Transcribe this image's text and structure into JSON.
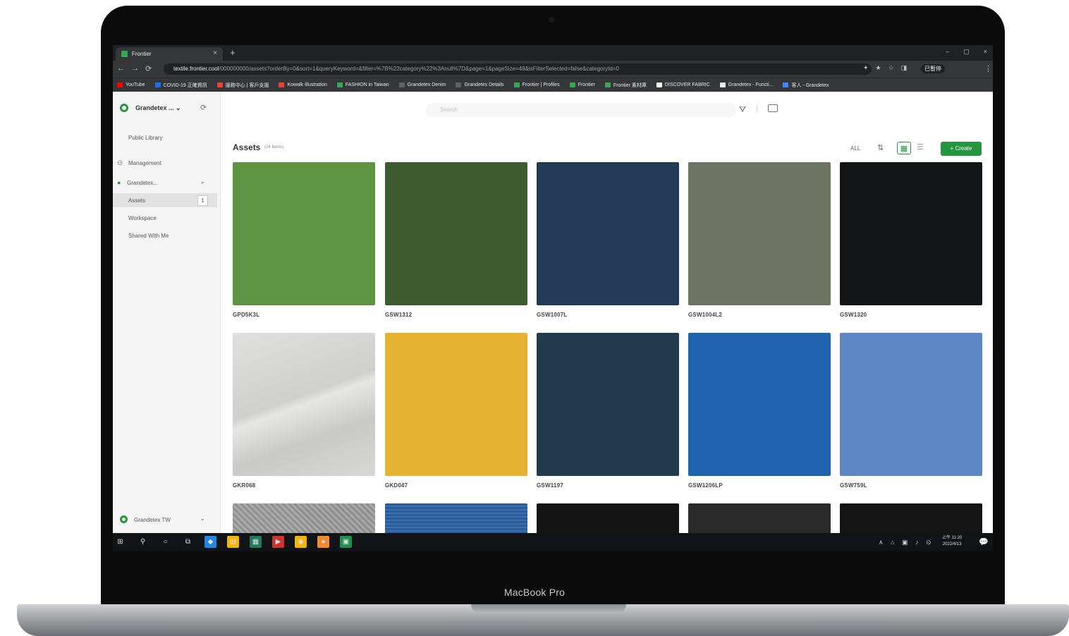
{
  "device": {
    "brand_label": "MacBook Pro"
  },
  "browser": {
    "tab_title": "Frontier",
    "tab_close": "×",
    "new_tab": "+",
    "window_controls": [
      "–",
      "▢",
      "×"
    ],
    "nav": {
      "back": "←",
      "forward": "→",
      "reload": "⟳",
      "lock": "🔒"
    },
    "url_host": "textile.frontier.cool",
    "url_rest": "/000000000/assets?orderBy=0&sort=1&queryKeyword=&filter=%7B%22category%22%3Anull%7D&page=1&pageSize=48&isFilterSelected=false&categoryId=0",
    "extensions": [
      "✦",
      "★",
      "☆",
      "◨"
    ],
    "profile_label": "已暫停",
    "bookmarks": [
      {
        "label": "YouTube",
        "color": "#ff0000"
      },
      {
        "label": "COVID-19 正確資訊",
        "color": "#1a73e8"
      },
      {
        "label": "服務中心 | 客戶支援",
        "color": "#ea4335"
      },
      {
        "label": "Kowalk Illustration",
        "color": "#ea4335"
      },
      {
        "label": "FASHION in Taiwan",
        "color": "#34a853"
      },
      {
        "label": "Grandetex Denim",
        "color": "#5f6368"
      },
      {
        "label": "Grandetex Details",
        "color": "#5f6368"
      },
      {
        "label": "Frontier | Profiles",
        "color": "#34a853"
      },
      {
        "label": "Frontier",
        "color": "#34a853"
      },
      {
        "label": "Frontier 素材庫",
        "color": "#34a853"
      },
      {
        "label": "DISCOVER FABRIC",
        "color": "#ffffff"
      },
      {
        "label": "Grandetex - Functi...",
        "color": "#e8eaed"
      },
      {
        "label": "客人 - Grandetex",
        "color": "#4285f4"
      }
    ]
  },
  "sidebar": {
    "org_name": "Grandetex ...",
    "org_caret": "⌄",
    "refresh_icon": "⟳",
    "public_library": "Public Library",
    "management": "Management",
    "team_name": "Grandetex...",
    "team_caret": "⌄",
    "items": [
      "Assets",
      "Workspace",
      "Shared With Me"
    ],
    "assets_badge": "1",
    "footer_team": "Grandetex TW",
    "footer_caret": "⌄"
  },
  "search": {
    "placeholder": "Search"
  },
  "assets": {
    "title": "Assets",
    "count": "(24 Items)"
  },
  "toolbar": {
    "sort_all": "ALL",
    "sort_icon": "⇅",
    "grid_icon": "▦",
    "list_icon": "☰",
    "create": "+ Create"
  },
  "cards": [
    {
      "code": "GPD5K3L",
      "color": "#5e9443"
    },
    {
      "code": "GSW1312",
      "color": "#3d5d30"
    },
    {
      "code": "GSW1007L",
      "color": "#223a55"
    },
    {
      "code": "GSW1004L2",
      "color": "#6d7562"
    },
    {
      "code": "GSW1320",
      "color": "#141516"
    },
    {
      "code": "GKR068",
      "color": "#d3d3d1"
    },
    {
      "code": "GKD047",
      "color": "#e6b331"
    },
    {
      "code": "GSW1197",
      "color": "#223a4e"
    },
    {
      "code": "GSW1206LP",
      "color": "#1f63ad"
    },
    {
      "code": "GSW759L",
      "color": "#5d88c5"
    },
    {
      "code": "",
      "color": "#9a9a9a"
    },
    {
      "code": "",
      "color": "#2b5c9a"
    },
    {
      "code": "",
      "color": "#141414"
    },
    {
      "code": "",
      "color": "#2a2a2a"
    },
    {
      "code": "",
      "color": "#151515"
    }
  ],
  "taskbar": {
    "start_icon": "⊞",
    "search_icon": "⚲",
    "apps": [
      "○",
      "⧉",
      "◆",
      "▤",
      "▦",
      "▶",
      "◉",
      "●",
      "▣"
    ],
    "tray": "∧ ⌂ ▣ ♪ ⊙",
    "time": "上午 11:20",
    "date": "2022/4/13",
    "notification": "💬"
  }
}
